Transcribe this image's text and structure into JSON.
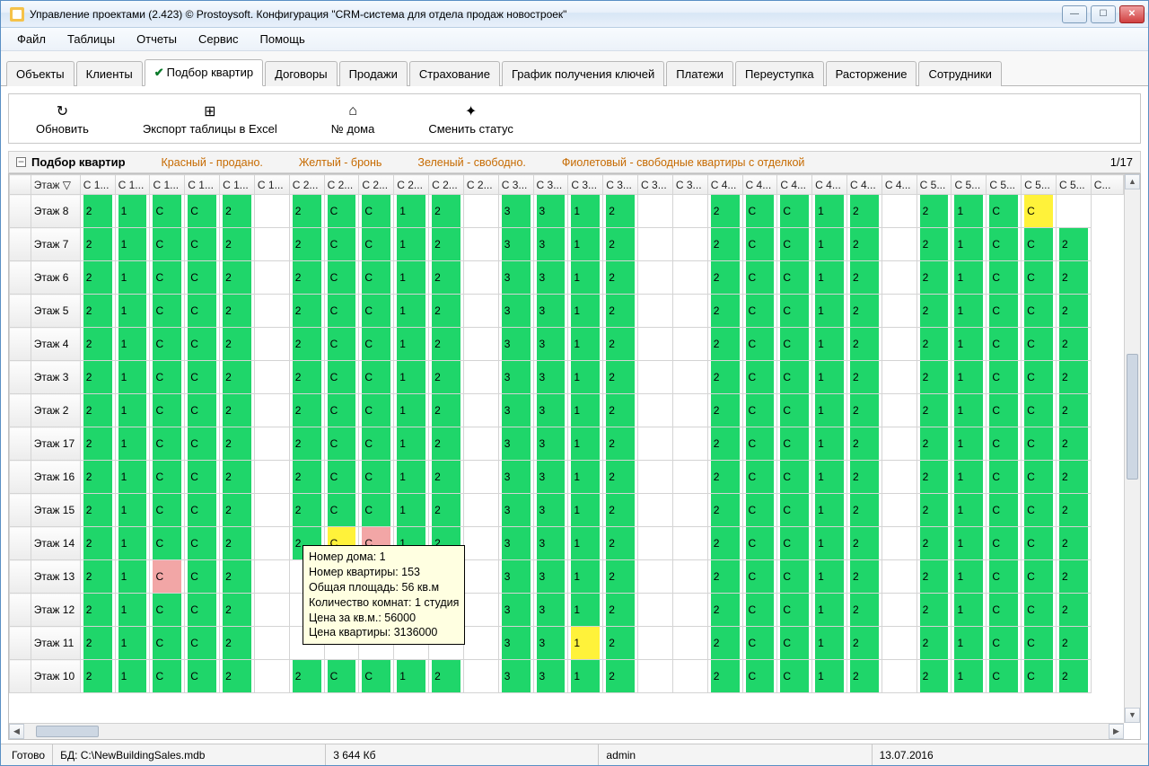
{
  "window": {
    "title": "Управление проектами (2.423) © Prostoysoft. Конфигурация \"CRM-система для отдела продаж новостроек\""
  },
  "menu": [
    "Файл",
    "Таблицы",
    "Отчеты",
    "Сервис",
    "Помощь"
  ],
  "tabs": [
    {
      "label": "Объекты",
      "active": false
    },
    {
      "label": "Клиенты",
      "active": false
    },
    {
      "label": "Подбор квартир",
      "active": true,
      "check": true
    },
    {
      "label": "Договоры",
      "active": false
    },
    {
      "label": "Продажи",
      "active": false
    },
    {
      "label": "Страхование",
      "active": false
    },
    {
      "label": "График получения ключей",
      "active": false
    },
    {
      "label": "Платежи",
      "active": false
    },
    {
      "label": "Переуступка",
      "active": false
    },
    {
      "label": "Расторжение",
      "active": false
    },
    {
      "label": "Сотрудники",
      "active": false
    }
  ],
  "toolbar": [
    {
      "label": "Обновить",
      "icon": "↻",
      "name": "refresh-button"
    },
    {
      "label": "Экспорт таблицы в Excel",
      "icon": "⊞",
      "name": "export-excel-button"
    },
    {
      "label": "№ дома",
      "icon": "⌂",
      "name": "house-number-button"
    },
    {
      "label": "Сменить статус",
      "icon": "✦",
      "name": "change-status-button"
    }
  ],
  "panel": {
    "title": "Подбор квартир",
    "legend_red": "Красный - продано.",
    "legend_yellow": "Желтый - бронь",
    "legend_green": "Зеленый - свободно.",
    "legend_violet": "Фиолетовый - свободные квартиры с отделкой",
    "counter": "1/17"
  },
  "grid": {
    "floor_label": "Этаж",
    "col_groups": [
      [
        "С 1...",
        "С 1...",
        "С 1...",
        "С 1...",
        "С 1...",
        "С 1..."
      ],
      [
        "С 2...",
        "С 2...",
        "С 2...",
        "С 2...",
        "С 2...",
        "С 2..."
      ],
      [
        "С 3...",
        "С 3...",
        "С 3...",
        "С 3...",
        "С 3...",
        "С 3..."
      ],
      [
        "С 4...",
        "С 4...",
        "С 4...",
        "С 4...",
        "С 4...",
        "С 4..."
      ],
      [
        "С 5...",
        "С 5...",
        "С 5...",
        "С 5...",
        "С 5...",
        "С..."
      ]
    ],
    "rows": [
      {
        "floor": "Этаж 8",
        "g": [
          [
            "2",
            "1",
            "C",
            "C",
            "2",
            ""
          ],
          [
            "2",
            "C",
            "C",
            "1",
            "2",
            ""
          ],
          [
            "3",
            "3",
            "1",
            "2",
            "",
            ""
          ],
          [
            "2",
            "C",
            "C",
            "1",
            "2",
            ""
          ],
          [
            "2",
            "1",
            "C",
            "C",
            ""
          ]
        ],
        "color": {
          "0,0": "green",
          "0,1": "green",
          "0,2": "green",
          "0,3": "green",
          "0,4": "green",
          "1,0": "green",
          "1,1": "green",
          "1,2": "green",
          "1,3": "green",
          "1,4": "green",
          "2,0": "green",
          "2,1": "green",
          "2,2": "green",
          "2,3": "green",
          "3,0": "green",
          "3,1": "green",
          "3,2": "green",
          "3,3": "green",
          "3,4": "green",
          "4,0": "green",
          "4,1": "green",
          "4,2": "green",
          "4,3": "yellow"
        }
      },
      {
        "floor": "Этаж 7",
        "g": [
          [
            "2",
            "1",
            "C",
            "C",
            "2",
            ""
          ],
          [
            "2",
            "C",
            "C",
            "1",
            "2",
            ""
          ],
          [
            "3",
            "3",
            "1",
            "2",
            "",
            ""
          ],
          [
            "2",
            "C",
            "C",
            "1",
            "2",
            ""
          ],
          [
            "2",
            "1",
            "C",
            "C",
            "2"
          ]
        ]
      },
      {
        "floor": "Этаж 6",
        "g": [
          [
            "2",
            "1",
            "C",
            "C",
            "2",
            ""
          ],
          [
            "2",
            "C",
            "C",
            "1",
            "2",
            ""
          ],
          [
            "3",
            "3",
            "1",
            "2",
            "",
            ""
          ],
          [
            "2",
            "C",
            "C",
            "1",
            "2",
            ""
          ],
          [
            "2",
            "1",
            "C",
            "C",
            "2"
          ]
        ]
      },
      {
        "floor": "Этаж 5",
        "g": [
          [
            "2",
            "1",
            "C",
            "C",
            "2",
            ""
          ],
          [
            "2",
            "C",
            "C",
            "1",
            "2",
            ""
          ],
          [
            "3",
            "3",
            "1",
            "2",
            "",
            ""
          ],
          [
            "2",
            "C",
            "C",
            "1",
            "2",
            ""
          ],
          [
            "2",
            "1",
            "C",
            "C",
            "2"
          ]
        ]
      },
      {
        "floor": "Этаж 4",
        "g": [
          [
            "2",
            "1",
            "C",
            "C",
            "2",
            ""
          ],
          [
            "2",
            "C",
            "C",
            "1",
            "2",
            ""
          ],
          [
            "3",
            "3",
            "1",
            "2",
            "",
            ""
          ],
          [
            "2",
            "C",
            "C",
            "1",
            "2",
            ""
          ],
          [
            "2",
            "1",
            "C",
            "C",
            "2"
          ]
        ]
      },
      {
        "floor": "Этаж 3",
        "g": [
          [
            "2",
            "1",
            "C",
            "C",
            "2",
            ""
          ],
          [
            "2",
            "C",
            "C",
            "1",
            "2",
            ""
          ],
          [
            "3",
            "3",
            "1",
            "2",
            "",
            ""
          ],
          [
            "2",
            "C",
            "C",
            "1",
            "2",
            ""
          ],
          [
            "2",
            "1",
            "C",
            "C",
            "2"
          ]
        ]
      },
      {
        "floor": "Этаж 2",
        "g": [
          [
            "2",
            "1",
            "C",
            "C",
            "2",
            ""
          ],
          [
            "2",
            "C",
            "C",
            "1",
            "2",
            ""
          ],
          [
            "3",
            "3",
            "1",
            "2",
            "",
            ""
          ],
          [
            "2",
            "C",
            "C",
            "1",
            "2",
            ""
          ],
          [
            "2",
            "1",
            "C",
            "C",
            "2"
          ]
        ]
      },
      {
        "floor": "Этаж 17",
        "g": [
          [
            "2",
            "1",
            "C",
            "C",
            "2",
            ""
          ],
          [
            "2",
            "C",
            "C",
            "1",
            "2",
            ""
          ],
          [
            "3",
            "3",
            "1",
            "2",
            "",
            ""
          ],
          [
            "2",
            "C",
            "C",
            "1",
            "2",
            ""
          ],
          [
            "2",
            "1",
            "C",
            "C",
            "2"
          ]
        ]
      },
      {
        "floor": "Этаж 16",
        "g": [
          [
            "2",
            "1",
            "C",
            "C",
            "2",
            ""
          ],
          [
            "2",
            "C",
            "C",
            "1",
            "2",
            ""
          ],
          [
            "3",
            "3",
            "1",
            "2",
            "",
            ""
          ],
          [
            "2",
            "C",
            "C",
            "1",
            "2",
            ""
          ],
          [
            "2",
            "1",
            "C",
            "C",
            "2"
          ]
        ]
      },
      {
        "floor": "Этаж 15",
        "g": [
          [
            "2",
            "1",
            "C",
            "C",
            "2",
            ""
          ],
          [
            "2",
            "C",
            "C",
            "1",
            "2",
            ""
          ],
          [
            "3",
            "3",
            "1",
            "2",
            "",
            ""
          ],
          [
            "2",
            "C",
            "C",
            "1",
            "2",
            ""
          ],
          [
            "2",
            "1",
            "C",
            "C",
            "2"
          ]
        ]
      },
      {
        "floor": "Этаж 14",
        "g": [
          [
            "2",
            "1",
            "C",
            "C",
            "2",
            ""
          ],
          [
            "2",
            "C",
            "C",
            "1",
            "2",
            ""
          ],
          [
            "3",
            "3",
            "1",
            "2",
            "",
            ""
          ],
          [
            "2",
            "C",
            "C",
            "1",
            "2",
            ""
          ],
          [
            "2",
            "1",
            "C",
            "C",
            "2"
          ]
        ],
        "special": {
          "1,1": "yellow",
          "1,2": "pink"
        }
      },
      {
        "floor": "Этаж 13",
        "g": [
          [
            "2",
            "1",
            "C",
            "C",
            "2",
            ""
          ],
          [
            "",
            "",
            "",
            "",
            "",
            ""
          ],
          [
            "3",
            "3",
            "1",
            "2",
            "",
            ""
          ],
          [
            "2",
            "C",
            "C",
            "1",
            "2",
            ""
          ],
          [
            "2",
            "1",
            "C",
            "C",
            "2"
          ]
        ],
        "special": {
          "0,2": "pink"
        }
      },
      {
        "floor": "Этаж 12",
        "g": [
          [
            "2",
            "1",
            "C",
            "C",
            "2",
            ""
          ],
          [
            "",
            "",
            "",
            "",
            "",
            ""
          ],
          [
            "3",
            "3",
            "1",
            "2",
            "",
            ""
          ],
          [
            "2",
            "C",
            "C",
            "1",
            "2",
            ""
          ],
          [
            "2",
            "1",
            "C",
            "C",
            "2"
          ]
        ]
      },
      {
        "floor": "Этаж 11",
        "g": [
          [
            "2",
            "1",
            "C",
            "C",
            "2",
            ""
          ],
          [
            "",
            "",
            "",
            "",
            "",
            ""
          ],
          [
            "3",
            "3",
            "1",
            "2",
            "",
            ""
          ],
          [
            "2",
            "C",
            "C",
            "1",
            "2",
            ""
          ],
          [
            "2",
            "1",
            "C",
            "C",
            "2"
          ]
        ],
        "special": {
          "2,2": "yellow"
        }
      },
      {
        "floor": "Этаж 10",
        "g": [
          [
            "2",
            "1",
            "C",
            "C",
            "2",
            ""
          ],
          [
            "2",
            "C",
            "C",
            "1",
            "2",
            ""
          ],
          [
            "3",
            "3",
            "1",
            "2",
            "",
            ""
          ],
          [
            "2",
            "C",
            "C",
            "1",
            "2",
            ""
          ],
          [
            "2",
            "1",
            "C",
            "C",
            "2"
          ]
        ]
      }
    ]
  },
  "tooltip": {
    "l1": "Номер дома: 1",
    "l2": "Номер квартиры:   153",
    "l3": "Общая площадь:   56 кв.м",
    "l4": "Количество комнат:  1 студия",
    "l5": "Цена за кв.м.:   56000",
    "l6": "Цена квартиры:   3136000"
  },
  "status": {
    "ready": "Готово",
    "db_label": "БД:",
    "db_path": "C:\\NewBuildingSales.mdb",
    "size": "3 644 Кб",
    "user": "admin",
    "date": "13.07.2016"
  }
}
